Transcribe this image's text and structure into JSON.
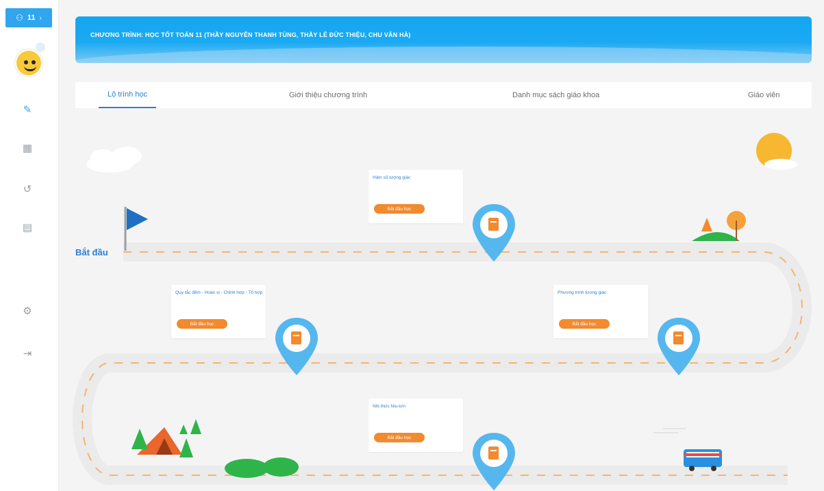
{
  "sidebar": {
    "top_badge": "11",
    "items": [
      {
        "name": "edit",
        "icon": "✎",
        "active": true
      },
      {
        "name": "library",
        "icon": "▦",
        "active": false
      },
      {
        "name": "history",
        "icon": "↺",
        "active": false
      },
      {
        "name": "document",
        "icon": "▤",
        "active": false
      },
      {
        "name": "settings",
        "icon": "⚙",
        "active": false
      },
      {
        "name": "logout",
        "icon": "⇥",
        "active": false
      }
    ]
  },
  "banner": {
    "title": "CHƯƠNG TRÌNH: HỌC TỐT TOÁN 11 (THẦY NGUYỄN THANH TÙNG, THẦY LÊ ĐỨC THIỆU, CHU VĂN HÀ)"
  },
  "tabs": [
    {
      "label": "Lộ trình học",
      "active": true
    },
    {
      "label": "Giới thiệu chương trình",
      "active": false
    },
    {
      "label": "Danh mục sách giáo khoa",
      "active": false
    },
    {
      "label": "Giáo viên",
      "active": false
    }
  ],
  "roadmap": {
    "start_label": "Bắt đầu",
    "lessons": [
      {
        "title": "Hàm số lượng giác",
        "button": "Bắt đầu học"
      },
      {
        "title": "Quy tắc đếm - Hoán vị - Chỉnh hợp - Tổ hợp",
        "button": "Bắt đầu học"
      },
      {
        "title": "Phương trình lượng giác",
        "button": "Bắt đầu học"
      },
      {
        "title": "Nhị thức Niu-tơn",
        "button": "Bắt đầu học"
      }
    ]
  },
  "colors": {
    "accent": "#2fa6ee",
    "button": "#f28a2e",
    "road": "#ebebeb",
    "road_dash": "#f3b56b",
    "pin": "#56b7ee"
  }
}
